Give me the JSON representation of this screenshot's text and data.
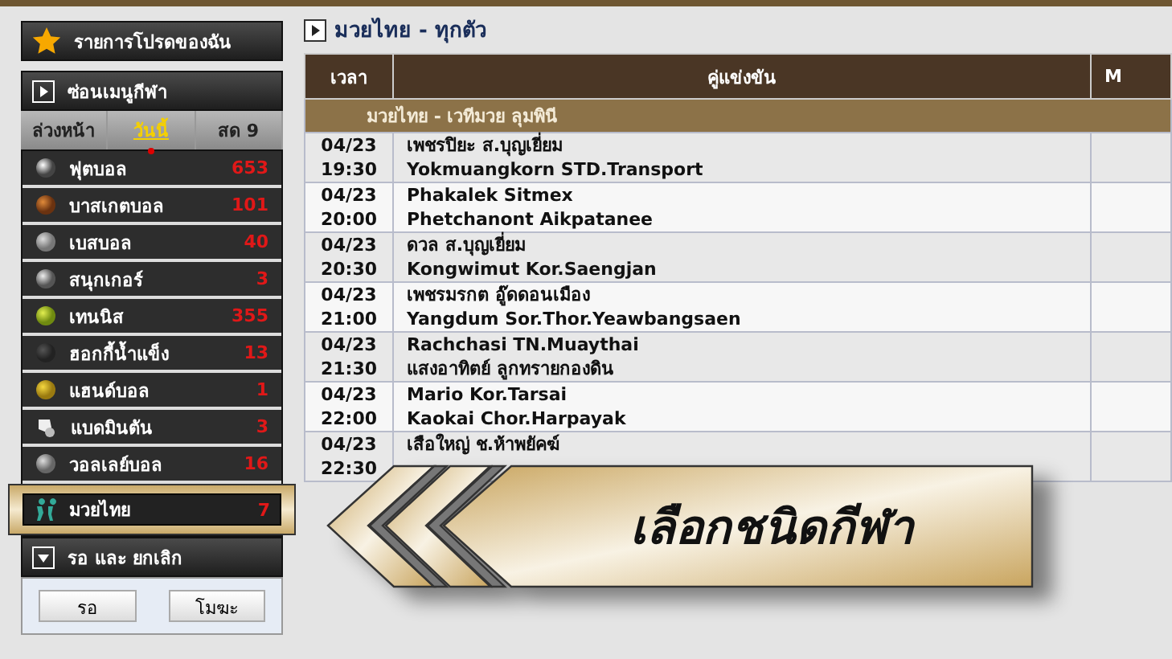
{
  "favorites": {
    "label": "รายการโปรดของฉัน"
  },
  "menu_toggle": {
    "label": "ซ่อนเมนูกีฬา"
  },
  "tabs": [
    {
      "label": "ล่วงหน้า",
      "selected": false
    },
    {
      "label": "วันนี้",
      "selected": true
    },
    {
      "label": "สด 9",
      "selected": false
    }
  ],
  "sports": [
    {
      "kind": "football",
      "name": "ฟุตบอล",
      "count": "653",
      "selected": false
    },
    {
      "kind": "basketball",
      "name": "บาสเกตบอล",
      "count": "101",
      "selected": false
    },
    {
      "kind": "baseball",
      "name": "เบสบอล",
      "count": "40",
      "selected": false
    },
    {
      "kind": "snooker",
      "name": "สนุกเกอร์",
      "count": "3",
      "selected": false
    },
    {
      "kind": "tennis",
      "name": "เทนนิส",
      "count": "355",
      "selected": false
    },
    {
      "kind": "hockey",
      "name": "ฮอกกี้น้ำแข็ง",
      "count": "13",
      "selected": false
    },
    {
      "kind": "handball",
      "name": "แฮนด์บอล",
      "count": "1",
      "selected": false
    },
    {
      "kind": "badminton",
      "name": "แบดมินตัน",
      "count": "3",
      "selected": false
    },
    {
      "kind": "volleyball",
      "name": "วอลเลย์บอล",
      "count": "16",
      "selected": false
    },
    {
      "kind": "boxing",
      "name": "มวยไทย",
      "count": "7",
      "selected": true
    }
  ],
  "pending": {
    "label": "รอ และ ยกเลิก"
  },
  "buttons": [
    "รอ",
    "โมฆะ"
  ],
  "main": {
    "title": "มวยไทย - ทุกตัว",
    "table": {
      "columns": [
        "เวลา",
        "คู่แข่งขัน",
        "M"
      ],
      "group": "มวยไทย - เวทีมวย ลุมพินี",
      "rows": [
        {
          "date": "04/23",
          "time": "19:30",
          "home": "เพชรปิยะ ส.บุญเยี่ยม",
          "away": "Yokmuangkorn STD.Transport"
        },
        {
          "date": "04/23",
          "time": "20:00",
          "home": "Phakalek Sitmex",
          "away": "Phetchanont Aikpatanee"
        },
        {
          "date": "04/23",
          "time": "20:30",
          "home": "ดวล ส.บุญเยี่ยม",
          "away": "Kongwimut Kor.Saengjan"
        },
        {
          "date": "04/23",
          "time": "21:00",
          "home": "เพชรมรกต อู๊ดดอนเมือง",
          "away": "Yangdum Sor.Thor.Yeawbangsaen"
        },
        {
          "date": "04/23",
          "time": "21:30",
          "home": "Rachchasi TN.Muaythai",
          "away": "แสงอาทิตย์ ลูกทรายกองดิน"
        },
        {
          "date": "04/23",
          "time": "22:00",
          "home": "Mario Kor.Tarsai",
          "away": "Kaokai Chor.Harpayak"
        },
        {
          "date": "04/23",
          "time": "22:30",
          "home": "เสือใหญ่ ช.ห้าพยัคฆ์"
        }
      ]
    }
  },
  "banner": {
    "text": "เลือกชนิดกีฬา"
  }
}
